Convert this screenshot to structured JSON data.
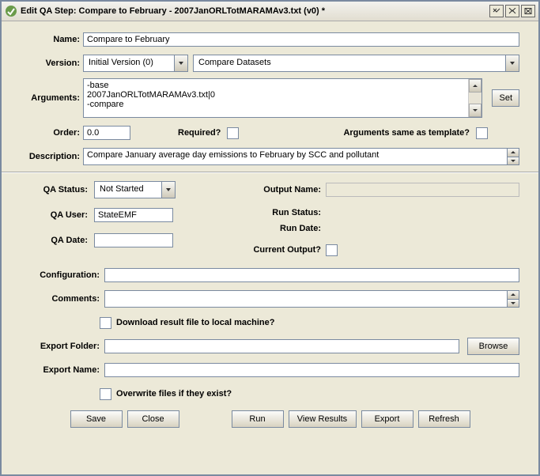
{
  "window": {
    "title": "Edit QA Step: Compare to February - 2007JanORLTotMARAMAv3.txt (v0) *"
  },
  "fields": {
    "name_label": "Name:",
    "name_value": "Compare to February",
    "version_label": "Version:",
    "version_value": "Initial Version (0)",
    "program_value": "Compare Datasets",
    "arguments_label": "Arguments:",
    "arguments_value": "-base\n2007JanORLTotMARAMAv3.txt|0\n-compare",
    "set_btn": "Set",
    "order_label": "Order:",
    "order_value": "0.0",
    "required_label": "Required?",
    "args_template_label": "Arguments same as template?",
    "description_label": "Description:",
    "description_value": "Compare January average day emissions to February by SCC and pollutant",
    "qa_status_label": "QA Status:",
    "qa_status_value": "Not Started",
    "qa_user_label": "QA User:",
    "qa_user_value": "StateEMF",
    "qa_date_label": "QA Date:",
    "qa_date_value": "",
    "output_name_label": "Output Name:",
    "run_status_label": "Run Status:",
    "run_date_label": "Run Date:",
    "current_output_label": "Current Output?",
    "configuration_label": "Configuration:",
    "configuration_value": "",
    "comments_label": "Comments:",
    "comments_value": "",
    "download_label": "Download result file to local machine?",
    "export_folder_label": "Export Folder:",
    "export_folder_value": "",
    "export_name_label": "Export Name:",
    "export_name_value": "",
    "browse_btn": "Browse",
    "overwrite_label": "Overwrite files if they exist?"
  },
  "buttons": {
    "save": "Save",
    "close": "Close",
    "run": "Run",
    "view_results": "View Results",
    "export": "Export",
    "refresh": "Refresh"
  }
}
